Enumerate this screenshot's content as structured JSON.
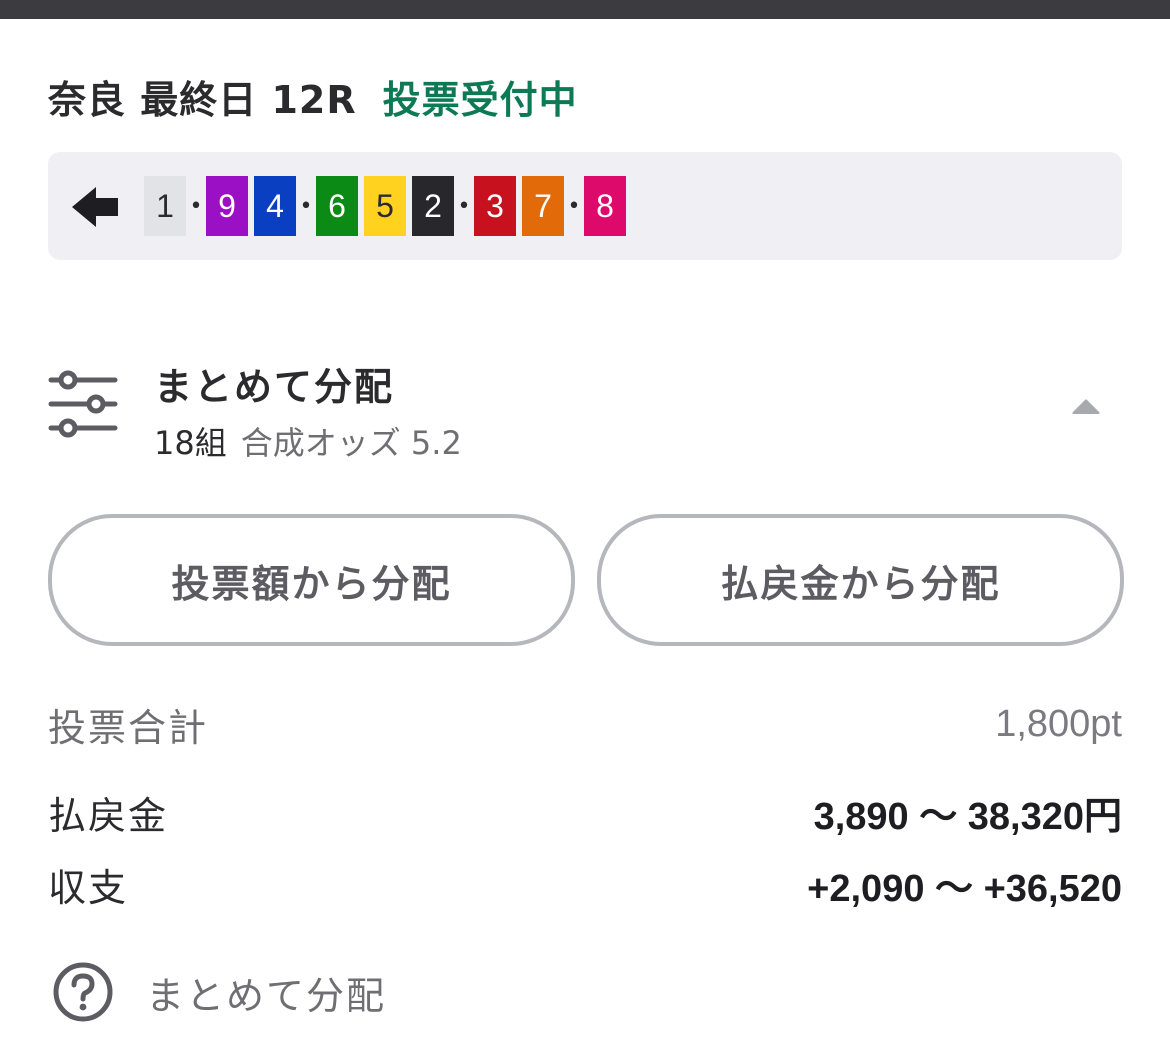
{
  "header": {
    "race_title": "奈良 最終日 12R",
    "status": "投票受付中",
    "status_color": "#0e7a55"
  },
  "combination": {
    "back_icon": "arrow-left-icon",
    "groups": [
      [
        {
          "num": "1",
          "bg": "#e2e3e6",
          "fg": "#2b2b2e"
        }
      ],
      [
        {
          "num": "9",
          "bg": "#9b10c4",
          "fg": "#ffffff"
        },
        {
          "num": "4",
          "bg": "#0a3fc2",
          "fg": "#ffffff"
        }
      ],
      [
        {
          "num": "6",
          "bg": "#0c8a16",
          "fg": "#ffffff"
        },
        {
          "num": "5",
          "bg": "#ffd21f",
          "fg": "#2b2b2e"
        },
        {
          "num": "2",
          "bg": "#28282c",
          "fg": "#ffffff"
        }
      ],
      [
        {
          "num": "3",
          "bg": "#c8111f",
          "fg": "#ffffff"
        },
        {
          "num": "7",
          "bg": "#e26a08",
          "fg": "#ffffff"
        }
      ],
      [
        {
          "num": "8",
          "bg": "#dd0a6c",
          "fg": "#ffffff"
        }
      ]
    ],
    "separator": "•"
  },
  "distribution": {
    "icon": "sliders-icon",
    "title": "まとめて分配",
    "count": "18組",
    "odds": "合成オッズ 5.2",
    "toggle_icon": "caret-up-icon"
  },
  "buttons": {
    "by_stake": "投票額から分配",
    "by_payout": "払戻金から分配"
  },
  "summary": {
    "total_label": "投票合計",
    "total_value": "1,800pt",
    "payout_label": "払戻金",
    "payout_value": "3,890 〜 38,320円",
    "balance_label": "収支",
    "balance_value": "+2,090 〜 +36,520"
  },
  "help": {
    "icon": "question-circle-icon",
    "label": "まとめて分配"
  }
}
